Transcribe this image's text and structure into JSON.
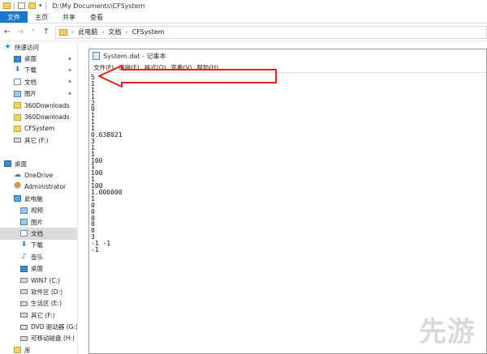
{
  "titlebar": {
    "path": "D:\\My Documents\\CFSystem"
  },
  "ribbon": {
    "tabs": [
      "文件",
      "主页",
      "共享",
      "查看"
    ]
  },
  "address": {
    "crumbs": [
      "此电脑",
      "文档",
      "CFSystem"
    ]
  },
  "sidebar": {
    "items": [
      {
        "label": "快速访问",
        "icon": "star-icon"
      },
      {
        "label": "桌面",
        "icon": "desktop-icon",
        "pinned": true
      },
      {
        "label": "下载",
        "icon": "download-icon",
        "pinned": true
      },
      {
        "label": "文档",
        "icon": "document-icon",
        "pinned": true
      },
      {
        "label": "图片",
        "icon": "picture-icon",
        "pinned": true
      },
      {
        "label": "360Downloads",
        "icon": "folder-icon"
      },
      {
        "label": "360Downloads",
        "icon": "folder-icon"
      },
      {
        "label": "CFSystem",
        "icon": "folder-icon"
      },
      {
        "label": "其它 (F:)",
        "icon": "drive-icon"
      },
      {
        "label": "",
        "icon": ""
      },
      {
        "label": "桌面",
        "icon": "desktop-icon"
      },
      {
        "label": "OneDrive",
        "icon": "cloud-icon"
      },
      {
        "label": "Administrator",
        "icon": "user-icon"
      },
      {
        "label": "此电脑",
        "icon": "computer-icon"
      },
      {
        "label": "视频",
        "icon": "video-icon"
      },
      {
        "label": "图片",
        "icon": "picture-icon"
      },
      {
        "label": "文档",
        "icon": "document-icon",
        "selected": true
      },
      {
        "label": "下载",
        "icon": "download-icon"
      },
      {
        "label": "音乐",
        "icon": "music-icon"
      },
      {
        "label": "桌面",
        "icon": "desktop-icon"
      },
      {
        "label": "WIN7 (C:)",
        "icon": "drive-icon"
      },
      {
        "label": "软件区 (D:)",
        "icon": "drive-icon"
      },
      {
        "label": "生活区 (E:)",
        "icon": "drive-icon"
      },
      {
        "label": "其它 (F:)",
        "icon": "drive-icon"
      },
      {
        "label": "DVD 驱动器 (G:)",
        "icon": "dvd-icon"
      },
      {
        "label": "可移动磁盘 (H:)",
        "icon": "drive-icon"
      },
      {
        "label": "库",
        "icon": "folder-icon"
      }
    ]
  },
  "notepad": {
    "title": "System.dat - 记事本",
    "menu": [
      "文件(F)",
      "编辑(E)",
      "格式(O)",
      "查看(V)",
      "帮助(H)"
    ],
    "lines": [
      "5",
      "1",
      "1",
      "1",
      "2",
      "0",
      "1",
      "1",
      "1",
      "0.638021",
      "3",
      "1",
      "1",
      "100",
      "1",
      "100",
      "1",
      "100",
      "1.000000",
      "1",
      "0",
      "0",
      "0",
      "0",
      "0",
      "3",
      "-1 -1",
      "-1"
    ]
  },
  "annotation": {
    "color": "#e0201b"
  },
  "watermark": "先游"
}
